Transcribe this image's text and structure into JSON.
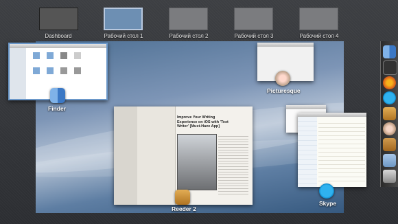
{
  "spaces": [
    {
      "label": "Dashboard"
    },
    {
      "label": "Рабочий стол 1"
    },
    {
      "label": "Рабочий стол 2"
    },
    {
      "label": "Рабочий стол 3"
    },
    {
      "label": "Рабочий стол 4"
    }
  ],
  "apps": {
    "finder": {
      "label": "Finder"
    },
    "picturesque": {
      "label": "Picturesque"
    },
    "reeder": {
      "label": "Reeder 2",
      "article_title": "Improve Your Writing Experience on iOS with 'Text Writer' [Must-Have App]"
    },
    "skype": {
      "label": "Skype"
    }
  },
  "dock": {
    "icons": [
      "finder-icon",
      "dashboard-icon",
      "firefox-icon",
      "skype-icon",
      "reeder-icon",
      "picturesque-icon",
      "textwriter-icon",
      "folder-icon",
      "trash-icon"
    ]
  }
}
